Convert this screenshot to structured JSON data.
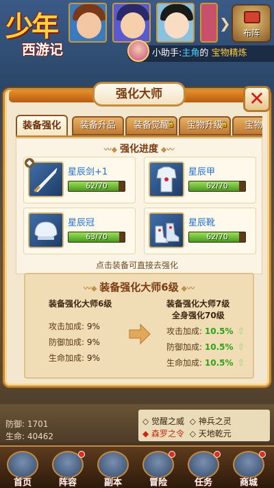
{
  "logo": {
    "big": "少年",
    "small": "西游记"
  },
  "topbar": {
    "layout_label": "布阵"
  },
  "helper": {
    "prefix": "小助手:",
    "role": "主角",
    "middle": "的",
    "item": "宝物精炼"
  },
  "dialog": {
    "title": "强化大师",
    "close_glyph": "✕",
    "tabs": [
      {
        "label": "装备强化",
        "active": true
      },
      {
        "label": "装备升品",
        "active": false
      },
      {
        "label": "装备觉醒",
        "active": false
      },
      {
        "label": "宝物升级",
        "active": false
      },
      {
        "label": "宝物精",
        "active": false
      }
    ],
    "progress_title": "强化进度",
    "items": [
      {
        "name": "星辰剑+1",
        "progress": "62/70",
        "fill": 0.886,
        "icon": "sword-icon"
      },
      {
        "name": "星辰甲",
        "progress": "62/70",
        "fill": 0.886,
        "icon": "armor-icon"
      },
      {
        "name": "星辰冠",
        "progress": "63/70",
        "fill": 0.9,
        "icon": "helmet-icon"
      },
      {
        "name": "星辰靴",
        "progress": "62/70",
        "fill": 0.886,
        "icon": "boots-icon"
      }
    ],
    "hint": "点击装备可直接去强化",
    "master": {
      "title": "装备强化大师6级",
      "current": {
        "title": "装备强化大师6级",
        "rows": [
          {
            "label": "攻击加成:",
            "value": "9%"
          },
          {
            "label": "防御加成:",
            "value": "9%"
          },
          {
            "label": "生命加成:",
            "value": "9%"
          }
        ]
      },
      "next": {
        "title": "装备强化大师7级",
        "subtitle": "全身强化70级",
        "rows": [
          {
            "label": "攻击加成:",
            "value": "10.5%"
          },
          {
            "label": "防御加成:",
            "value": "10.5%"
          },
          {
            "label": "生命加成:",
            "value": "10.5%"
          }
        ]
      }
    }
  },
  "background": {
    "defense": "防御:",
    "defense_val": "1701",
    "life": "生命:",
    "life_val": "40462",
    "skills": [
      "觉醒之威",
      "神兵之灵",
      "森罗之令",
      "天地乾元"
    ]
  },
  "bottom_nav": [
    "首页",
    "阵容",
    "副本",
    "冒险",
    "任务",
    "商城"
  ]
}
